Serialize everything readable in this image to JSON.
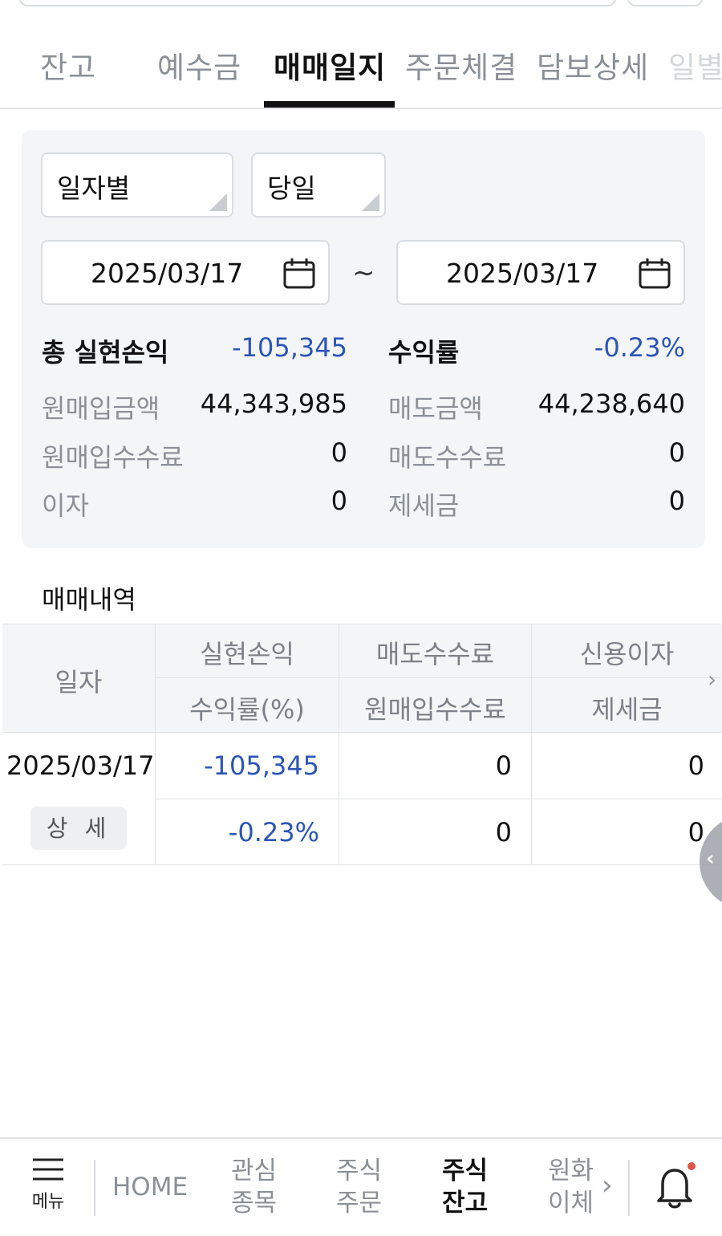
{
  "tabs": [
    {
      "label": "잔고"
    },
    {
      "label": "예수금"
    },
    {
      "label": "매매일지"
    },
    {
      "label": "주문체결"
    },
    {
      "label": "담보상세"
    },
    {
      "label": "일별"
    }
  ],
  "filters": {
    "period_type": "일자별",
    "range": "당일",
    "start_date": "2025/03/17",
    "end_date": "2025/03/17",
    "separator": "~"
  },
  "summary": {
    "total_pl_label": "총 실현손익",
    "total_pl_value": "-105,345",
    "return_label": "수익률",
    "return_value": "-0.23%",
    "buy_amount_label": "원매입금액",
    "buy_amount_value": "44,343,985",
    "sell_amount_label": "매도금액",
    "sell_amount_value": "44,238,640",
    "buy_fee_label": "원매입수수료",
    "buy_fee_value": "0",
    "sell_fee_label": "매도수수료",
    "sell_fee_value": "0",
    "interest_label": "이자",
    "interest_value": "0",
    "tax_label": "제세금",
    "tax_value": "0"
  },
  "history": {
    "title": "매매내역",
    "headers": {
      "date": "일자",
      "realized_pl": "실현손익",
      "sell_fee": "매도수수료",
      "credit_interest": "신용이자",
      "return_pct": "수익률(%)",
      "buy_fee": "원매입수수료",
      "tax": "제세금"
    },
    "rows": [
      {
        "date": "2025/03/17",
        "detail_label": "상 세",
        "realized_pl": "-105,345",
        "sell_fee": "0",
        "credit_interest": "0",
        "return_pct": "-0.23%",
        "buy_fee": "0",
        "tax": "0"
      }
    ]
  },
  "bottom_nav": {
    "menu_label": "메뉴",
    "home_label": "HOME",
    "watchlist_line1": "관심",
    "watchlist_line2": "종목",
    "order_line1": "주식",
    "order_line2": "주문",
    "balance_line1": "주식",
    "balance_line2": "잔고",
    "transfer_line1": "원화",
    "transfer_line2": "이체"
  },
  "colors": {
    "accent_blue": "#2b55b8",
    "panel_bg": "#f4f5f7",
    "muted_text": "#8b9097",
    "notification_dot": "#e0524a"
  }
}
